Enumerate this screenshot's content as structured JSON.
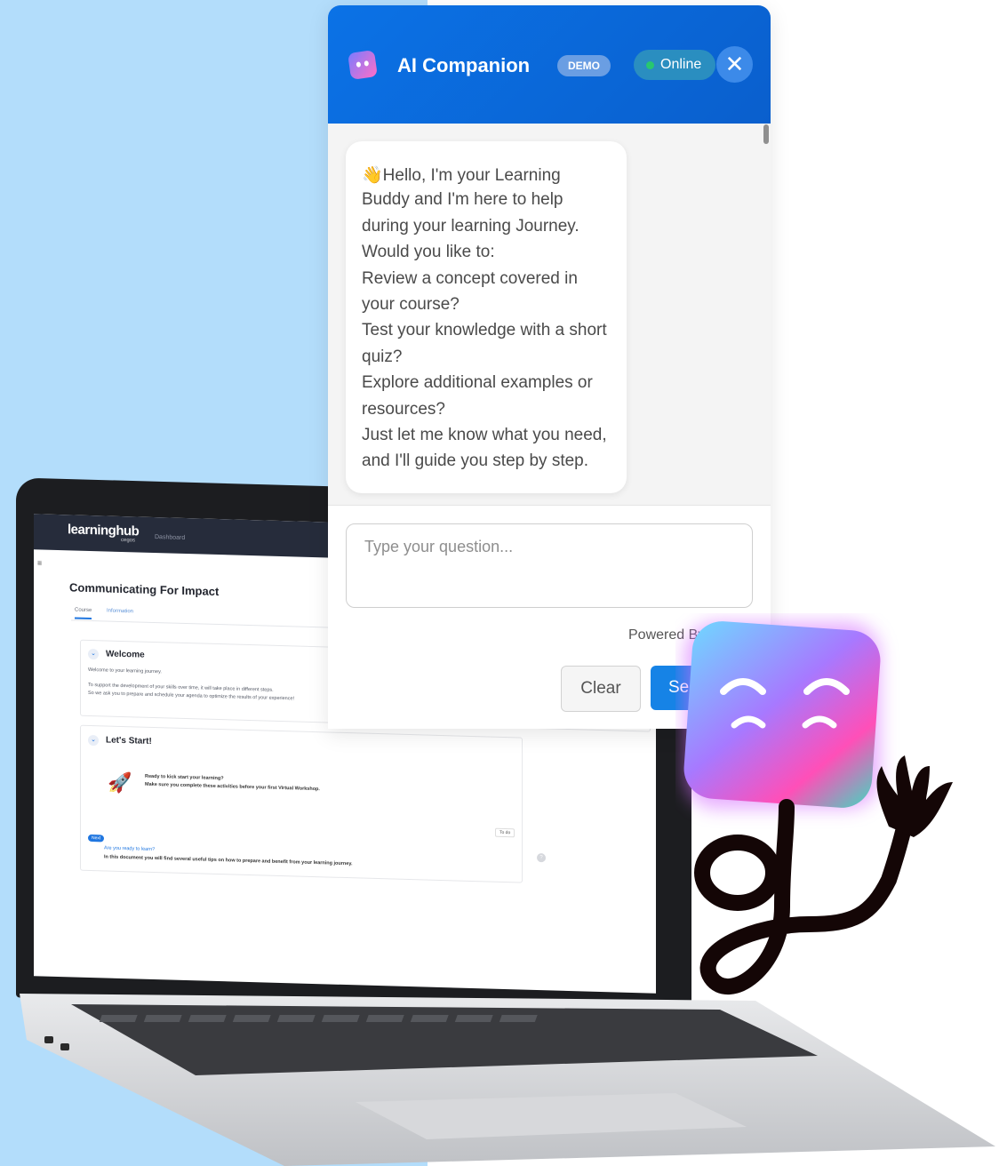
{
  "chat": {
    "title": "AI Companion",
    "demo_badge": "DEMO",
    "status": "Online",
    "close_icon": "close-icon",
    "message_lines": [
      "Hello, I'm your Learning",
      "Buddy and I'm here to help",
      "during your learning Journey.",
      "Would you like to:",
      "Review a concept covered in",
      "your course?",
      "Test your knowledge with a short",
      "quiz?",
      "Explore additional examples or",
      "resources?",
      "Just let me know what you need,",
      "and I'll guide you step by step."
    ],
    "wave_emoji": "👋",
    "input_placeholder": "Type your question...",
    "powered_by": "Powered By",
    "clear_label": "Clear",
    "send_label": "Se"
  },
  "lms": {
    "logo": "learninghub",
    "logo_sub": "cegos",
    "nav_label": "Dashboard",
    "course_title": "Communicating For Impact",
    "tabs": [
      "Course",
      "Information"
    ],
    "welcome": {
      "title": "Welcome",
      "lines": [
        "Welcome to your learning journey.",
        "To support the development of your skills over time, it will take place in different steps.",
        "So we ask you to prepare and schedule your agenda to optimize the results of your experience!"
      ]
    },
    "start": {
      "title": "Let's Start!",
      "line1": "Ready to kick start your learning?",
      "line2": "Make sure you complete these activities before your first Virtual Workshop.",
      "status": "To do",
      "next_badge": "Next",
      "link": "Are you ready to learn?",
      "desc": "In this document you will find several useful tips on how to prepare and benefit from your learning journey."
    }
  },
  "colors": {
    "header_blue": "#0b72e6",
    "send_blue": "#1683e6",
    "page_bg_blue": "#b3ddfb",
    "online_dot": "#28c76f"
  }
}
